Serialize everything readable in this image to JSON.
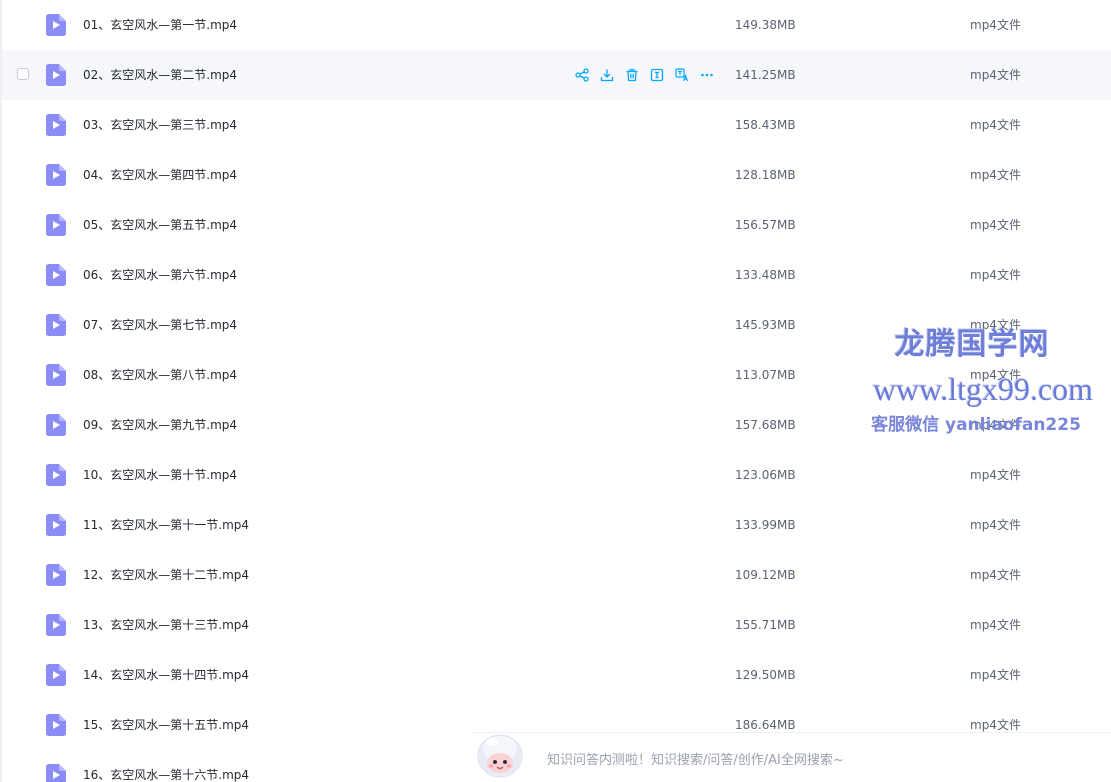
{
  "files": [
    {
      "name": "01、玄空风水—第一节.mp4",
      "size": "149.38MB",
      "type": "mp4文件"
    },
    {
      "name": "02、玄空风水—第二节.mp4",
      "size": "141.25MB",
      "type": "mp4文件"
    },
    {
      "name": "03、玄空风水—第三节.mp4",
      "size": "158.43MB",
      "type": "mp4文件"
    },
    {
      "name": "04、玄空风水—第四节.mp4",
      "size": "128.18MB",
      "type": "mp4文件"
    },
    {
      "name": "05、玄空风水—第五节.mp4",
      "size": "156.57MB",
      "type": "mp4文件"
    },
    {
      "name": "06、玄空风水—第六节.mp4",
      "size": "133.48MB",
      "type": "mp4文件"
    },
    {
      "name": "07、玄空风水—第七节.mp4",
      "size": "145.93MB",
      "type": "mp4文件"
    },
    {
      "name": "08、玄空风水—第八节.mp4",
      "size": "113.07MB",
      "type": "mp4文件"
    },
    {
      "name": "09、玄空风水—第九节.mp4",
      "size": "157.68MB",
      "type": "mp4文件"
    },
    {
      "name": "10、玄空风水—第十节.mp4",
      "size": "123.06MB",
      "type": "mp4文件"
    },
    {
      "name": "11、玄空风水—第十一节.mp4",
      "size": "133.99MB",
      "type": "mp4文件"
    },
    {
      "name": "12、玄空风水—第十二节.mp4",
      "size": "109.12MB",
      "type": "mp4文件"
    },
    {
      "name": "13、玄空风水—第十三节.mp4",
      "size": "155.71MB",
      "type": "mp4文件"
    },
    {
      "name": "14、玄空风水—第十四节.mp4",
      "size": "129.50MB",
      "type": "mp4文件"
    },
    {
      "name": "15、玄空风水—第十五节.mp4",
      "size": "186.64MB",
      "type": "mp4文件"
    },
    {
      "name": "16、玄空风水—第十六节.mp4",
      "size": "",
      "type": ""
    }
  ],
  "hover_row_index": 1,
  "row_actions": [
    "share-icon",
    "download-icon",
    "delete-icon",
    "rename-icon",
    "translate-icon",
    "more-icon"
  ],
  "watermark": {
    "title": "龙腾国学网",
    "url": "www.ltgx99.com",
    "contact": "客服微信 yanliaofan225"
  },
  "assistant": {
    "text": "知识问答内测啦！知识搜索/问答/创作/AI全网搜索~"
  },
  "colors": {
    "accent": "#06a7ff",
    "video_icon": "#8b8cf6",
    "watermark": "#6f7fd8"
  }
}
